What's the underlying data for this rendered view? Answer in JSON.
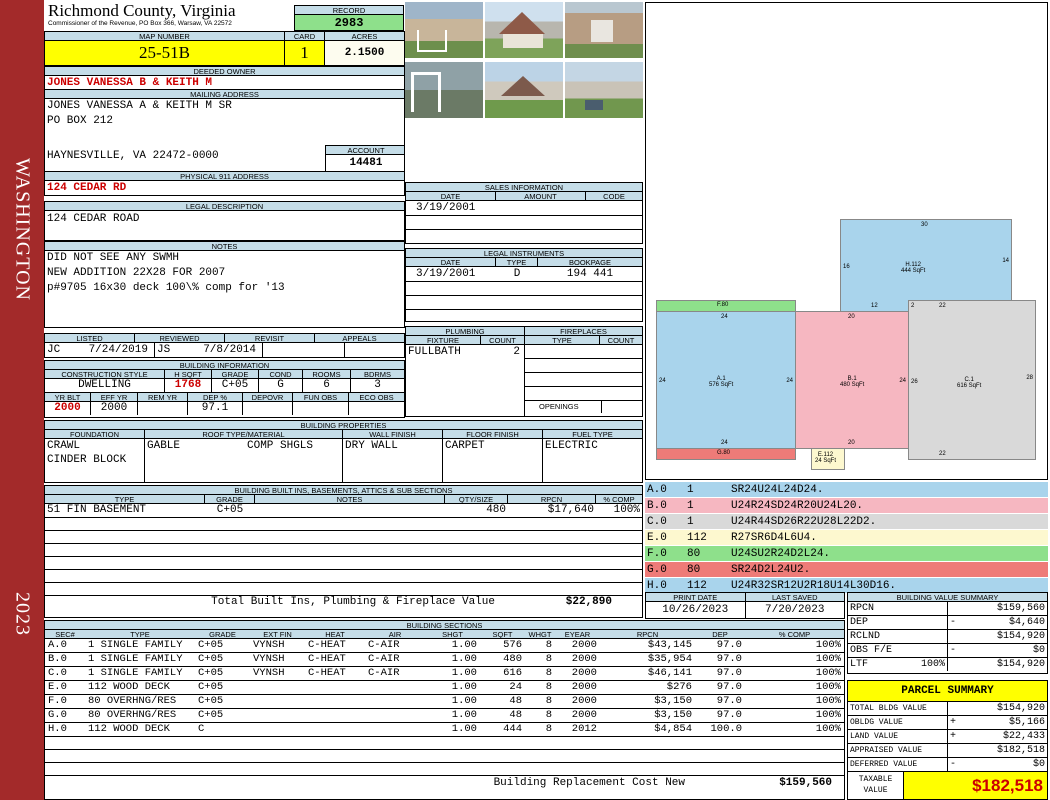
{
  "sidebar": {
    "district": "WASHINGTON",
    "year": "2023"
  },
  "county": {
    "name": "Richmond County, Virginia",
    "subtitle": "Commissioner of the Revenue, PO Box 366, Warsaw, VA 22572"
  },
  "record": {
    "label": "RECORD",
    "value": "2983"
  },
  "map": {
    "label": "MAP NUMBER",
    "value": "25-51B",
    "card_label": "CARD",
    "card": "1",
    "acres_label": "ACRES",
    "acres": "2.1500"
  },
  "owner": {
    "label": "DEEDED OWNER",
    "name": "JONES VANESSA B & KEITH M",
    "mail_label": "MAILING ADDRESS",
    "mail1": "JONES VANESSA A & KEITH M  SR",
    "mail2": "PO BOX 212",
    "mail3": "HAYNESVILLE, VA 22472-0000",
    "account_label": "ACCOUNT",
    "account": "14481"
  },
  "physical": {
    "label": "PHYSICAL 911 ADDRESS",
    "value": "124 CEDAR RD"
  },
  "legal": {
    "label": "LEGAL DESCRIPTION",
    "value": "124 CEDAR ROAD"
  },
  "notes": {
    "label": "NOTES",
    "l1": "DID NOT SEE ANY SWMH",
    "l2": "NEW ADDITION 22X28 FOR 2007",
    "l3": "p#9705 16x30 deck 100\\% comp for '13"
  },
  "visit": {
    "listed_label": "LISTED",
    "reviewed_label": "REVIEWED",
    "revisit_label": "REVISIT",
    "appeals_label": "APPEALS",
    "listed_by": "JC",
    "listed_date": "7/24/2019",
    "reviewed_by": "JS",
    "reviewed_date": "7/8/2014"
  },
  "building": {
    "label": "BUILDING INFORMATION",
    "h": [
      "CONSTRUCTION STYLE",
      "H SQFT",
      "GRADE",
      "COND",
      "ROOMS",
      "BDRMS"
    ],
    "style": "DWELLING",
    "hsqft": "1768",
    "grade": "C+05",
    "cond": "G",
    "rooms": "6",
    "bdrms": "3",
    "h2": [
      "YR BLT",
      "EFF YR",
      "REM YR",
      "DEP %",
      "DEPOVR",
      "FUN OBS",
      "ECO OBS"
    ],
    "yrblt": "2000",
    "effyr": "2000",
    "dep": "97.1"
  },
  "sales": {
    "label": "SALES INFORMATION",
    "h": [
      "DATE",
      "AMOUNT",
      "CODE"
    ],
    "date": "3/19/2001"
  },
  "instruments": {
    "label": "LEGAL INSTRUMENTS",
    "h": [
      "DATE",
      "TYPE",
      "BOOKPAGE"
    ],
    "date": "3/19/2001",
    "type": "D",
    "book": "194 441"
  },
  "plumbing": {
    "label": "PLUMBING",
    "fixture_label": "FIXTURE",
    "count_label": "COUNT",
    "fixture": "FULLBATH",
    "count": "2"
  },
  "fireplaces": {
    "label": "FIREPLACES",
    "type_label": "TYPE",
    "count_label": "COUNT",
    "openings": "OPENINGS"
  },
  "props": {
    "label": "BUILDING PROPERTIES",
    "h": [
      "FOUNDATION",
      "ROOF TYPE/MATERIAL",
      "WALL FINISH",
      "FLOOR FINISH",
      "FUEL TYPE"
    ],
    "f1": "CRAWL",
    "f2": "CINDER BLOCK",
    "roof1": "GABLE",
    "roof2": "COMP SHGLS",
    "wall": "DRY WALL",
    "floor": "CARPET",
    "fuel": "ELECTRIC"
  },
  "builtins": {
    "label": "BUILDING BUILT INS, BASEMENTS, ATTICS & SUB SECTIONS",
    "h": [
      "TYPE",
      "GRADE",
      "NOTES",
      "QTY/SIZE",
      "RPCN",
      "% COMP"
    ],
    "row": [
      "51 FIN BASEMENT",
      "C+05",
      "",
      "480",
      "$17,640",
      "100%"
    ],
    "total_label": "Total Built Ins, Plumbing & Fireplace Value",
    "total": "$22,890"
  },
  "codes": [
    {
      "k": "A.0",
      "n": "1",
      "c": "SR24U24L24D24.",
      "bg": "#a9d4ec"
    },
    {
      "k": "B.0",
      "n": "1",
      "c": "U24R24SD24R20U24L20.",
      "bg": "#f6b7c1"
    },
    {
      "k": "C.0",
      "n": "1",
      "c": "U24R44SD26R22U28L22D2.",
      "bg": "#d9d9d9"
    },
    {
      "k": "E.0",
      "n": "112",
      "c": "R27SR6D4L6U4.",
      "bg": "#fdf8cf"
    },
    {
      "k": "F.0",
      "n": "80",
      "c": "U24SU2R24D2L24.",
      "bg": "#8ee08b"
    },
    {
      "k": "G.0",
      "n": "80",
      "c": "SR24D2L24U2.",
      "bg": "#ee7b78"
    },
    {
      "k": "H.0",
      "n": "112",
      "c": "U24R32SR12U2R18U14L30D16.",
      "bg": "#a9d4ec"
    }
  ],
  "sketch": {
    "a": "A.1",
    "a_sq": "576 SqFt",
    "b": "B.1",
    "b_sq": "480 SqFt",
    "c": "C.1",
    "c_sq": "616 SqFt",
    "e": "E.112",
    "e_sq": "24 SqFt",
    "f": "F.80",
    "g": "G.80",
    "h": "H.112",
    "h_sq": "444 SqFt"
  },
  "dates": {
    "print_label": "PRINT DATE",
    "saved_label": "LAST SAVED",
    "print": "10/26/2023",
    "saved": "7/20/2023"
  },
  "bvs": {
    "label": "BUILDING VALUE SUMMARY",
    "rpcn_l": "RPCN",
    "rpcn": "$159,560",
    "dep_l": "DEP",
    "dep_s": "-",
    "dep": "$4,640",
    "rclnd_l": "RCLND",
    "rclnd": "$154,920",
    "obs_l": "OBS F/E",
    "obs_s": "-",
    "obs": "$0",
    "ltf_l": "LTF",
    "ltf_p": "100%",
    "ltf": "$154,920"
  },
  "parcel": {
    "label": "PARCEL SUMMARY",
    "tbv_l": "TOTAL BLDG VALUE",
    "tbv": "$154,920",
    "obv_l": "OBLDG VALUE",
    "obv_s": "+",
    "obv": "$5,166",
    "land_l": "LAND VALUE",
    "land_s": "+",
    "land": "$22,433",
    "appr_l": "APPRAISED VALUE",
    "appr": "$182,518",
    "def_l": "DEFERRED VALUE",
    "def_s": "-",
    "def": "$0",
    "tax_l1": "TAXABLE",
    "tax_l2": "VALUE",
    "tax": "$182,518"
  },
  "sections": {
    "label": "BUILDING SECTIONS",
    "h": [
      "SEC#",
      "TYPE",
      "GRADE",
      "EXT FIN",
      "HEAT",
      "AIR",
      "SHGT",
      "SQFT",
      "WHGT",
      "EYEAR",
      "RPCN",
      "DEP",
      "% COMP"
    ],
    "rows": [
      [
        "A.0",
        "1 SINGLE FAMILY",
        "C+05",
        "VYNSH",
        "C-HEAT",
        "C-AIR",
        "1.00",
        "576",
        "8",
        "2000",
        "$43,145",
        "97.0",
        "100%"
      ],
      [
        "B.0",
        "1 SINGLE FAMILY",
        "C+05",
        "VYNSH",
        "C-HEAT",
        "C-AIR",
        "1.00",
        "480",
        "8",
        "2000",
        "$35,954",
        "97.0",
        "100%"
      ],
      [
        "C.0",
        "1 SINGLE FAMILY",
        "C+05",
        "VYNSH",
        "C-HEAT",
        "C-AIR",
        "1.00",
        "616",
        "8",
        "2000",
        "$46,141",
        "97.0",
        "100%"
      ],
      [
        "E.0",
        "112 WOOD DECK",
        "C+05",
        "",
        "",
        "",
        "1.00",
        "24",
        "8",
        "2000",
        "$276",
        "97.0",
        "100%"
      ],
      [
        "F.0",
        "80 OVERHNG/RES",
        "C+05",
        "",
        "",
        "",
        "1.00",
        "48",
        "8",
        "2000",
        "$3,150",
        "97.0",
        "100%"
      ],
      [
        "G.0",
        "80 OVERHNG/RES",
        "C+05",
        "",
        "",
        "",
        "1.00",
        "48",
        "8",
        "2000",
        "$3,150",
        "97.0",
        "100%"
      ],
      [
        "H.0",
        "112 WOOD DECK",
        "C",
        "",
        "",
        "",
        "1.00",
        "444",
        "8",
        "2012",
        "$4,854",
        "100.0",
        "100%"
      ]
    ],
    "total_label": "Building Replacement Cost New",
    "total": "$159,560"
  }
}
